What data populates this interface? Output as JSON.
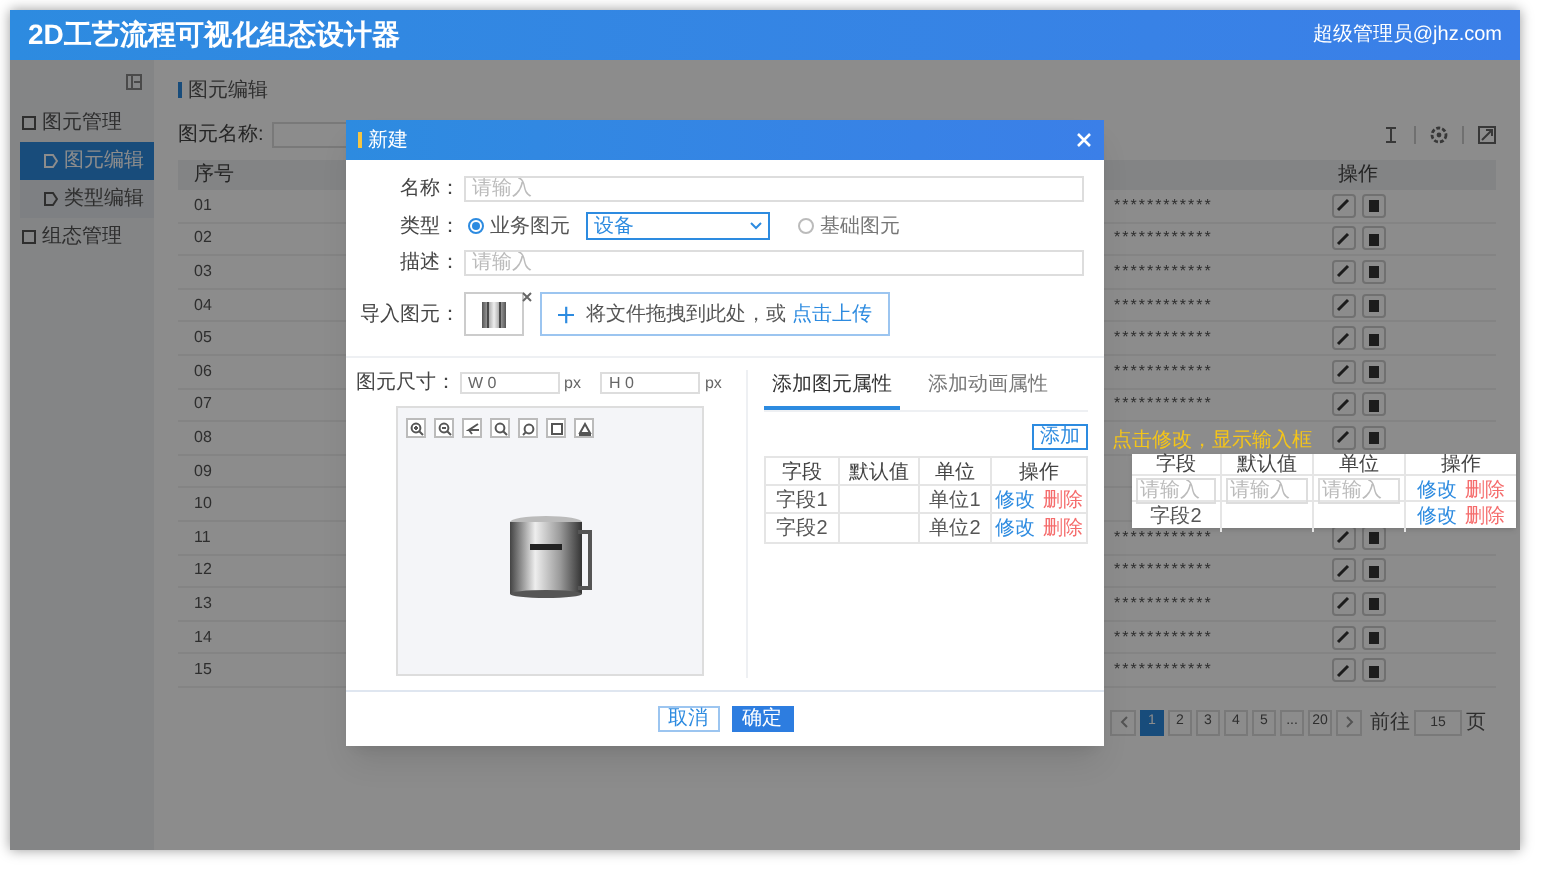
{
  "header": {
    "title": "2D工艺流程可视化组态设计器",
    "user": "超级管理员@jhz.com"
  },
  "sidebar": {
    "items": [
      {
        "label": "图元管理",
        "selected": false,
        "children": [
          {
            "label": "图元编辑",
            "selected": true
          },
          {
            "label": "类型编辑",
            "selected": false
          }
        ]
      },
      {
        "label": "组态管理",
        "selected": false
      }
    ]
  },
  "breadcrumb": "图元编辑",
  "search": {
    "label": "图元名称:"
  },
  "table": {
    "columns": [
      "序号",
      "操作"
    ],
    "rows": [
      {
        "no": "01",
        "masked": "************"
      },
      {
        "no": "02",
        "masked": "************"
      },
      {
        "no": "03",
        "masked": "************"
      },
      {
        "no": "04",
        "masked": "************"
      },
      {
        "no": "05",
        "masked": "************"
      },
      {
        "no": "06",
        "masked": "************"
      },
      {
        "no": "07",
        "masked": "************"
      },
      {
        "no": "08"
      },
      {
        "no": "09"
      },
      {
        "no": "10"
      },
      {
        "no": "11",
        "masked": "************"
      },
      {
        "no": "12",
        "masked": "************"
      },
      {
        "no": "13",
        "masked": "************"
      },
      {
        "no": "14",
        "masked": "************"
      },
      {
        "no": "15",
        "masked": "************"
      }
    ]
  },
  "pagination": {
    "pages": [
      {
        "label": "1",
        "selected": true
      },
      {
        "label": "2",
        "selected": false
      },
      {
        "label": "3",
        "selected": false
      },
      {
        "label": "4",
        "selected": false
      },
      {
        "label": "5",
        "selected": false
      },
      {
        "label": "...",
        "selected": false
      },
      {
        "label": "20",
        "selected": false
      }
    ],
    "jump_label": "前往",
    "jump_value": "15",
    "unit": "页"
  },
  "dialog": {
    "title": "新建",
    "name": {
      "label": "名称：",
      "placeholder": "请输入"
    },
    "type": {
      "label": "类型：",
      "options": [
        {
          "label": "业务图元",
          "selected": true
        },
        {
          "label": "基础图元",
          "selected": false
        }
      ],
      "select_value": "设备"
    },
    "description": {
      "label": "描述：",
      "placeholder": "请输入"
    },
    "import": {
      "label": "导入图元：",
      "hint": "将文件拖拽到此处，或",
      "link": "点击上传"
    },
    "size": {
      "label": "图元尺寸：",
      "width": "W 0",
      "width_unit": "px",
      "height": "H 0",
      "height_unit": "px"
    },
    "tabs": [
      {
        "label": "添加图元属性",
        "selected": true
      },
      {
        "label": "添加动画属性",
        "selected": false
      }
    ],
    "add_button": "添加",
    "columns": [
      "字段",
      "默认值",
      "单位",
      "操作"
    ],
    "rows": [
      {
        "field": "字段1",
        "unit": "单位1",
        "actions": [
          "修改",
          "删除"
        ]
      },
      {
        "field": "字段2",
        "unit": "单位2",
        "actions": [
          "修改",
          "删除"
        ]
      }
    ],
    "buttons": [
      {
        "label": "取消",
        "kind": "secondary"
      },
      {
        "label": "确定",
        "kind": "primary"
      }
    ]
  },
  "popup": {
    "note": "点击修改，显示输入框",
    "columns": [
      "字段",
      "默认值",
      "单位",
      "操作"
    ],
    "rows": [
      {
        "kind": "editing",
        "placeholders": [
          "请输入",
          "请输入",
          "请输入"
        ],
        "actions": [
          "修改",
          "删除"
        ]
      },
      {
        "kind": "text",
        "field": "字段2",
        "actions": [
          "修改",
          "删除"
        ]
      }
    ]
  }
}
